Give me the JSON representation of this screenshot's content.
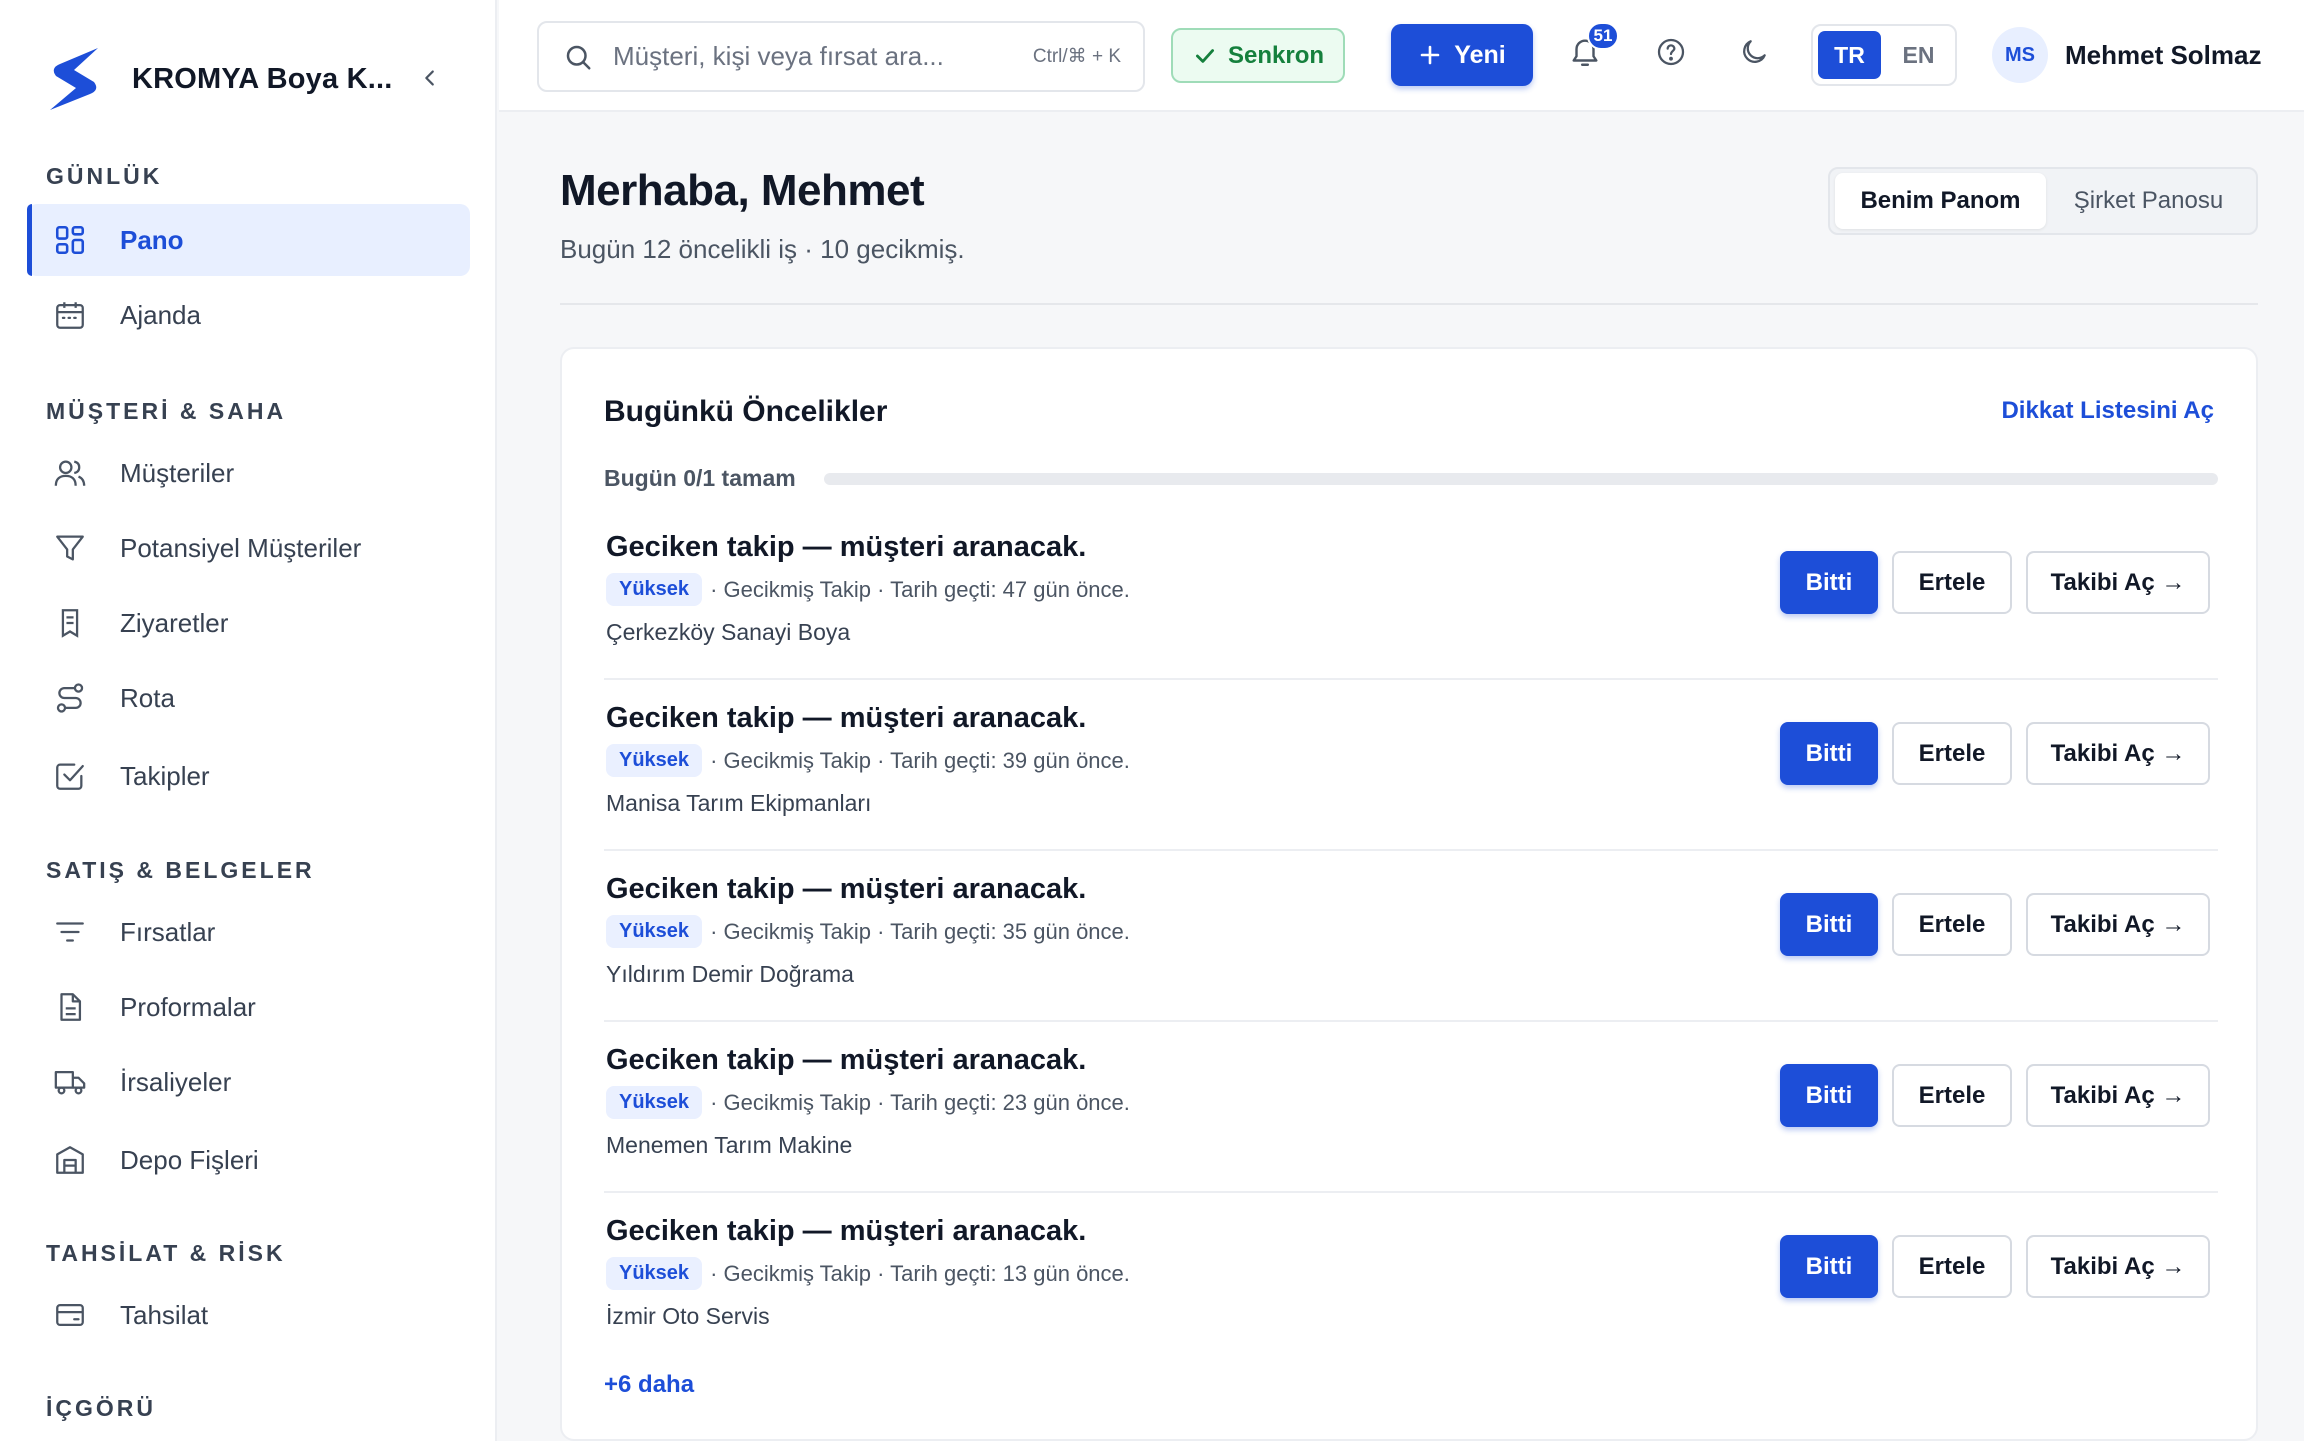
{
  "brand": {
    "name": "KROMYA Boya K...",
    "color": "#1d4ed8"
  },
  "sidebar": {
    "sections": [
      {
        "title": "GÜNLÜK"
      },
      {
        "title": "MÜŞTERİ & SAHA"
      },
      {
        "title": "SATIŞ & BELGELER"
      },
      {
        "title": "TAHSİLAT & RİSK"
      },
      {
        "title": "İÇGÖRÜ"
      }
    ],
    "items": [
      {
        "label": "Pano",
        "icon": "grid-icon",
        "active": true
      },
      {
        "label": "Ajanda",
        "icon": "calendar-icon"
      },
      {
        "label": "Müşteriler",
        "icon": "users-icon"
      },
      {
        "label": "Potansiyel Müşteriler",
        "icon": "filter-icon"
      },
      {
        "label": "Ziyaretler",
        "icon": "bookmark-icon"
      },
      {
        "label": "Rota",
        "icon": "route-icon"
      },
      {
        "label": "Takipler",
        "icon": "checkbox-icon"
      },
      {
        "label": "Fırsatlar",
        "icon": "list-filter-icon"
      },
      {
        "label": "Proformalar",
        "icon": "document-icon"
      },
      {
        "label": "İrsaliyeler",
        "icon": "truck-icon"
      },
      {
        "label": "Depo Fişleri",
        "icon": "warehouse-icon"
      },
      {
        "label": "Tahsilat",
        "icon": "wallet-icon"
      }
    ]
  },
  "topbar": {
    "search_placeholder": "Müşteri, kişi veya fırsat ara...",
    "search_shortcut": "Ctrl/⌘ + K",
    "sync_label": "Senkron",
    "new_label": "Yeni",
    "notification_count": "51",
    "languages": [
      {
        "code": "TR",
        "active": true
      },
      {
        "code": "EN",
        "active": false
      }
    ],
    "user": {
      "initials": "MS",
      "name": "Mehmet Solmaz"
    }
  },
  "main": {
    "greeting": "Merhaba, Mehmet",
    "subtitle": "Bugün 12 öncelikli iş · 10 gecikmiş.",
    "board_tabs": [
      {
        "label": "Benim Panom",
        "active": true
      },
      {
        "label": "Şirket Panosu",
        "active": false
      }
    ],
    "priorities": {
      "title": "Bugünkü Öncelikler",
      "link": "Dikkat Listesini Aç",
      "progress_label": "Bugün 0/1 tamam",
      "progress_fraction": 0,
      "tasks": [
        {
          "title": "Geciken takip — müşteri aranacak.",
          "priority": "Yüksek",
          "meta": "· Gecikmiş Takip · Tarih geçti: 47 gün önce.",
          "company": "Çerkezköy Sanayi Boya"
        },
        {
          "title": "Geciken takip — müşteri aranacak.",
          "priority": "Yüksek",
          "meta": "· Gecikmiş Takip · Tarih geçti: 39 gün önce.",
          "company": "Manisa Tarım Ekipmanları"
        },
        {
          "title": "Geciken takip — müşteri aranacak.",
          "priority": "Yüksek",
          "meta": "· Gecikmiş Takip · Tarih geçti: 35 gün önce.",
          "company": "Yıldırım Demir Doğrama"
        },
        {
          "title": "Geciken takip — müşteri aranacak.",
          "priority": "Yüksek",
          "meta": "· Gecikmiş Takip · Tarih geçti: 23 gün önce.",
          "company": "Menemen Tarım Makine"
        },
        {
          "title": "Geciken takip — müşteri aranacak.",
          "priority": "Yüksek",
          "meta": "· Gecikmiş Takip · Tarih geçti: 13 gün önce.",
          "company": "İzmir Oto Servis"
        }
      ],
      "actions": {
        "done": "Bitti",
        "snooze": "Ertele",
        "open": "Takibi Aç →"
      },
      "more": "+6 daha"
    }
  }
}
